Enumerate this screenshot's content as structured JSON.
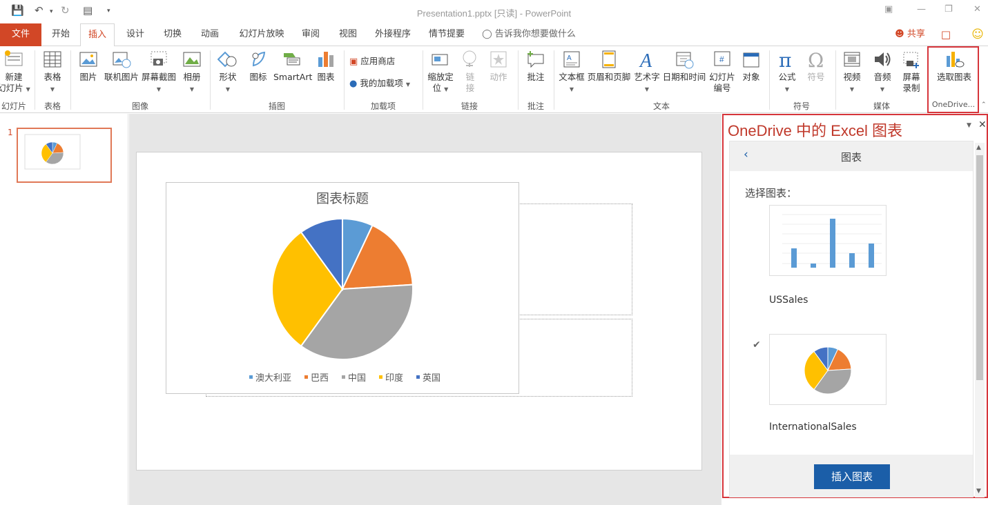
{
  "window": {
    "title": "Presentation1.pptx [只读] - PowerPoint"
  },
  "tabs": [
    "文件",
    "开始",
    "插入",
    "设计",
    "切换",
    "动画",
    "幻灯片放映",
    "审阅",
    "视图",
    "外接程序",
    "情节提要"
  ],
  "tell_me": "告诉我你想要做什么",
  "share": "共享",
  "ribbon": {
    "new_slide": [
      "新建",
      "幻灯片"
    ],
    "table": "表格",
    "picture": "图片",
    "online_picture": "联机图片",
    "screenshot": "屏幕截图",
    "album": "相册",
    "shapes": "形状",
    "icons": "图标",
    "smartart": "SmartArt",
    "chart": "图表",
    "store": "应用商店",
    "my_addins": "我的加载项",
    "zoom": [
      "缩放定",
      "位"
    ],
    "link": [
      "链",
      "接"
    ],
    "action": "动作",
    "comment": "批注",
    "textbox": "文本框",
    "header_footer": "页眉和页脚",
    "wordart": "艺术字",
    "datetime": "日期和时间",
    "slide_number": [
      "幻灯片",
      "编号"
    ],
    "object": "对象",
    "equation": "公式",
    "symbol": "符号",
    "video": "视频",
    "audio": "音频",
    "screen_record": [
      "屏幕",
      "录制"
    ],
    "select_chart": "选取图表",
    "groups": {
      "slides": "幻灯片",
      "tables": "表格",
      "images": "图像",
      "illustrations": "插图",
      "addins": "加载项",
      "links": "链接",
      "comments": "批注",
      "text": "文本",
      "symbols": "符号",
      "media": "媒体",
      "onedrive": "OneDrive..."
    }
  },
  "slide_number": "1",
  "chart_data": {
    "type": "pie",
    "title": "图表标题",
    "categories": [
      "澳大利亚",
      "巴西",
      "中国",
      "印度",
      "英国"
    ],
    "values": [
      7,
      17,
      36,
      30,
      10
    ],
    "colors": [
      "#5b9bd5",
      "#ed7d31",
      "#a5a5a5",
      "#ffc000",
      "#4472c4"
    ]
  },
  "pane": {
    "title": "OneDrive 中的 Excel 图表",
    "header": "图表",
    "prompt": "选择图表：",
    "item1": "USSales",
    "item2": "InternationalSales",
    "insert_button": "插入图表"
  }
}
